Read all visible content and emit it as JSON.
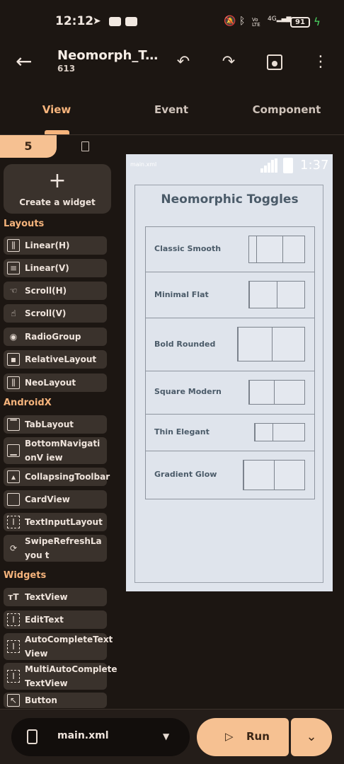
{
  "status_bar": {
    "time": "12:12",
    "battery": "91"
  },
  "app_bar": {
    "title": "Neomorph_Tog...",
    "subtitle": "613"
  },
  "tabs": [
    {
      "label": "View"
    },
    {
      "label": "Event"
    },
    {
      "label": "Component"
    }
  ],
  "side_panel": {
    "active_tab_glyph": "5",
    "create_widget_label": "Create a widget",
    "sections": [
      {
        "title": "Layouts"
      },
      {
        "title": "AndroidX"
      },
      {
        "title": "Widgets"
      }
    ],
    "layouts": [
      "Linear(H)",
      "Linear(V)",
      "Scroll(H)",
      "Scroll(V)",
      "RadioGroup",
      "RelativeLayout",
      "NeoLayout"
    ],
    "androidx": [
      "TabLayout",
      "BottomNavigationV iew",
      "CollapsingToolbar",
      "CardView",
      "TextInputLayout",
      "SwipeRefreshLayou t"
    ],
    "widgets": [
      "TextView",
      "EditText",
      "AutoCompleteText View",
      "MultiAutoComplete TextView",
      "Button"
    ]
  },
  "preview": {
    "file_label": "main.xml",
    "clock": "1:37",
    "heading": "Neomorphic Toggles",
    "rows": [
      {
        "label": "Classic Smooth"
      },
      {
        "label": "Minimal Flat"
      },
      {
        "label": "Bold Rounded"
      },
      {
        "label": "Square Modern"
      },
      {
        "label": "Thin Elegant"
      },
      {
        "label": "Gradient Glow"
      }
    ]
  },
  "bottom_bar": {
    "file": "main.xml",
    "run_label": "Run"
  },
  "colors": {
    "accent": "#f6b47c",
    "button": "#f6c192",
    "background": "#1c1612",
    "preview_bg": "#dfe4ec"
  }
}
